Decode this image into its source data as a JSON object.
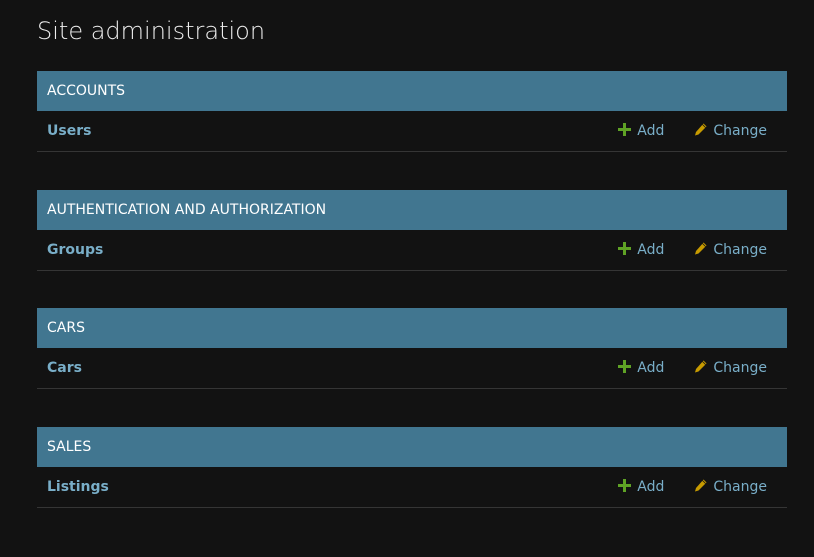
{
  "page": {
    "title": "Site administration"
  },
  "actions": {
    "add_label": "Add",
    "change_label": "Change"
  },
  "colors": {
    "background": "#121212",
    "header": "#417690",
    "link": "#79aec8",
    "add_icon": "#5fa225",
    "change_icon": "#c79b00"
  },
  "modules": [
    {
      "header": "ACCOUNTS",
      "model": "Users"
    },
    {
      "header": "AUTHENTICATION AND AUTHORIZATION",
      "model": "Groups"
    },
    {
      "header": "CARS",
      "model": "Cars"
    },
    {
      "header": "SALES",
      "model": "Listings"
    }
  ]
}
